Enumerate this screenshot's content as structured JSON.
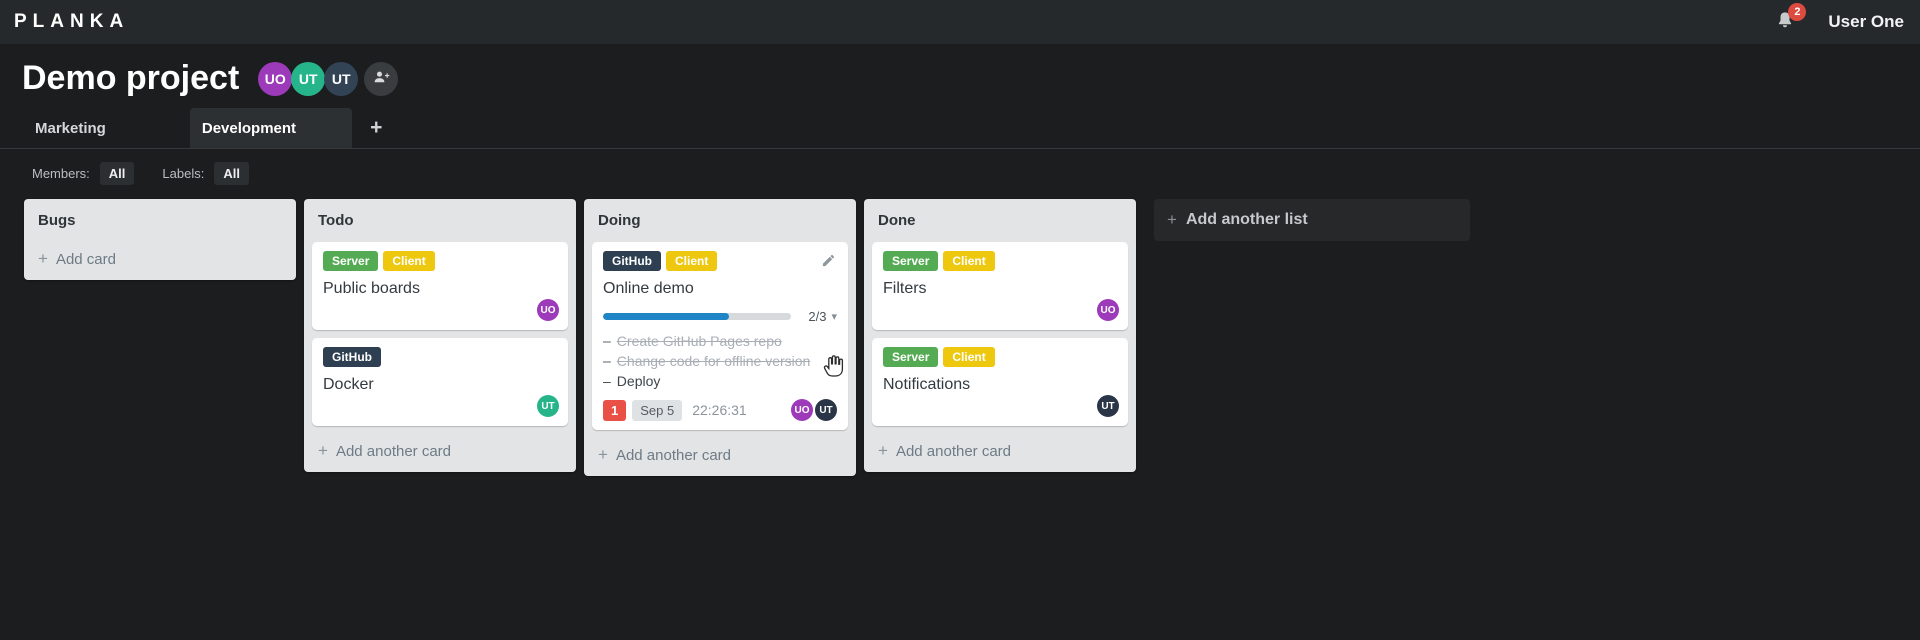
{
  "colors": {
    "topbar_bg": "#26292b",
    "page_bg": "#1b1d1f",
    "list_bg": "#e2e4e6",
    "card_bg": "#ffffff",
    "label_green": "#54ab54",
    "label_yellow": "#eec80e",
    "label_navy": "#2e3f52",
    "progress_blue": "#1f85c7",
    "bell_badge_red": "#dd4a3f",
    "card_badge_red": "#ea5146",
    "avatar_purple": "#9c3ab9",
    "avatar_teal": "#26b58a",
    "avatar_navy": "#334356",
    "avatar_dark": "#2a3647"
  },
  "icons": {
    "plus": "+",
    "chevron_down": "▾",
    "task_bullet": "–"
  },
  "topbar": {
    "logo": "PLANKA",
    "user_name": "User One",
    "notification_count": "2"
  },
  "project": {
    "title": "Demo project",
    "members": [
      {
        "initials": "UO"
      },
      {
        "initials": "UT"
      },
      {
        "initials": "UT"
      }
    ]
  },
  "tabs": {
    "marketing": "Marketing",
    "development": "Development"
  },
  "filters": {
    "members_label": "Members:",
    "members_value": "All",
    "labels_label": "Labels:",
    "labels_value": "All"
  },
  "board": {
    "add_list": "Add another list",
    "lists": [
      {
        "title": "Bugs",
        "add_card": "Add card",
        "cards": []
      },
      {
        "title": "Todo",
        "add_card": "Add another card",
        "cards": [
          {
            "title": "Public boards",
            "labels": [
              "Server",
              "Client"
            ],
            "member": "UO"
          },
          {
            "title": "Docker",
            "labels": [
              "GitHub"
            ],
            "member": "UT"
          }
        ]
      },
      {
        "title": "Doing",
        "add_card": "Add another card",
        "cards": [
          {
            "title": "Online demo",
            "labels": [
              "GitHub",
              "Client"
            ],
            "progress": {
              "label": "2/3",
              "percent": 67
            },
            "tasks": [
              {
                "text": "Create GitHub Pages repo",
                "done": true
              },
              {
                "text": "Change code for offline version",
                "done": true
              },
              {
                "text": "Deploy",
                "done": false
              }
            ],
            "notification_count": "1",
            "due_date": "Sep 5",
            "timer": "22:26:31",
            "members": [
              "UO",
              "UT"
            ]
          }
        ]
      },
      {
        "title": "Done",
        "add_card": "Add another card",
        "cards": [
          {
            "title": "Filters",
            "labels": [
              "Server",
              "Client"
            ],
            "member": "UO"
          },
          {
            "title": "Notifications",
            "labels": [
              "Server",
              "Client"
            ],
            "member": "UT"
          }
        ]
      }
    ]
  }
}
